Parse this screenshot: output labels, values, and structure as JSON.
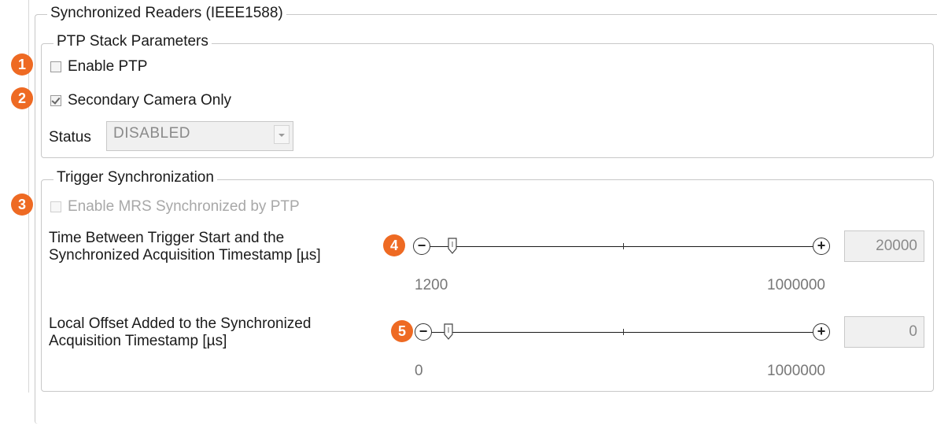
{
  "section_title": "Synchronized Readers (IEEE1588)",
  "ptp_stack": {
    "title": "PTP Stack Parameters",
    "enable_ptp": {
      "label": "Enable PTP",
      "checked": false
    },
    "secondary_camera_only": {
      "label": "Secondary Camera Only",
      "checked": true
    },
    "status": {
      "label": "Status",
      "value": "DISABLED"
    }
  },
  "trigger_sync": {
    "title": "Trigger Synchronization",
    "enable_mrs": {
      "label": "Enable MRS Synchronized by PTP",
      "checked": false,
      "disabled": true
    },
    "trigger_time": {
      "label_line1": "Time Between Trigger Start and the",
      "label_line2": "Synchronized Acquisition Timestamp [µs]",
      "min_label": "1200",
      "max_label": "1000000",
      "value": "20000",
      "minus": "−",
      "plus": "+"
    },
    "local_offset": {
      "label_line1": "Local Offset Added to the Synchronized",
      "label_line2": "Acquisition Timestamp [µs]",
      "min_label": "0",
      "max_label": "1000000",
      "value": "0",
      "minus": "−",
      "plus": "+"
    }
  },
  "badges": [
    "1",
    "2",
    "3",
    "4",
    "5"
  ],
  "colors": {
    "badge": "#ee6a23",
    "border": "#c8c8c8",
    "disabled_text": "#a8a8a8"
  }
}
